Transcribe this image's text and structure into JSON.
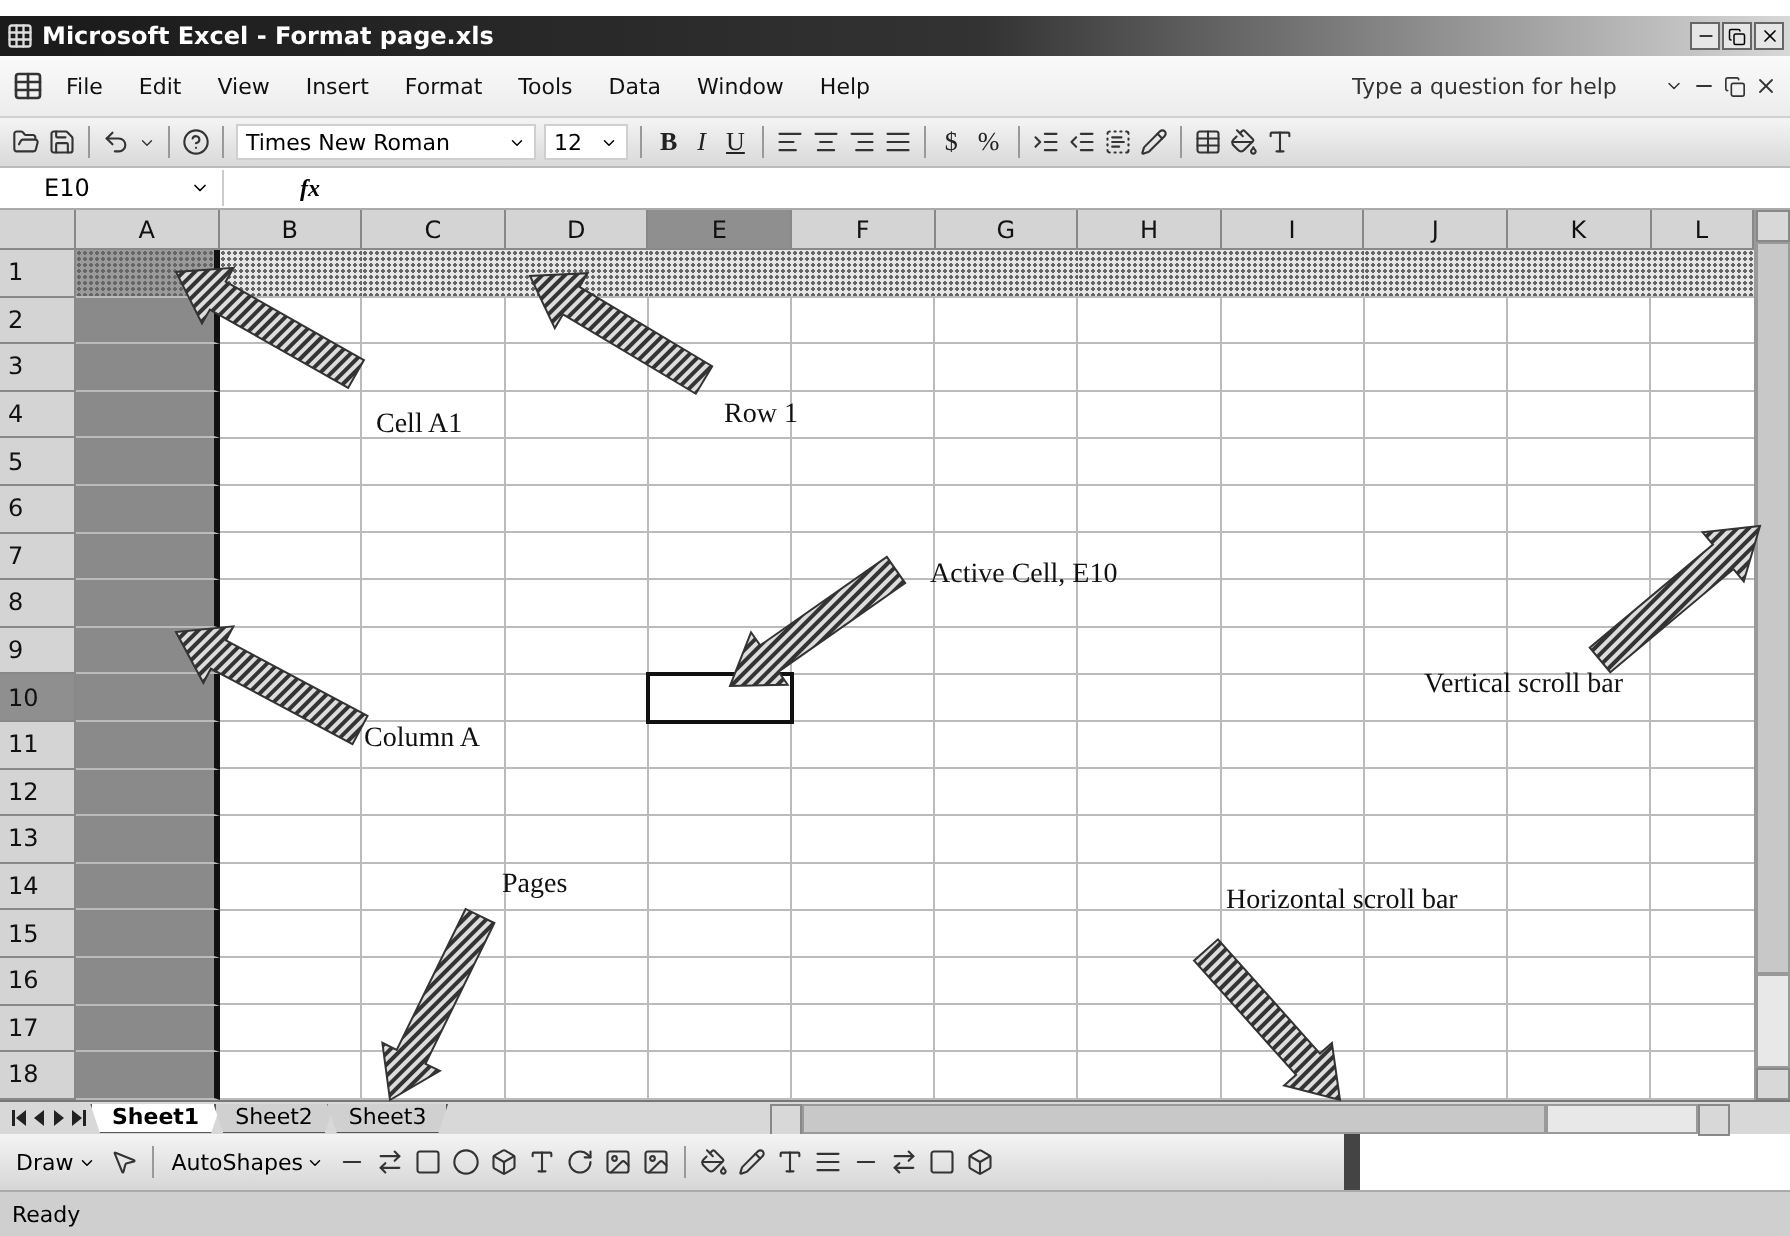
{
  "window": {
    "title": "Microsoft Excel - Format page.xls"
  },
  "menu": [
    "File",
    "Edit",
    "View",
    "Insert",
    "Format",
    "Tools",
    "Data",
    "Window",
    "Help"
  ],
  "help_box": {
    "placeholder": "Type a question for help"
  },
  "toolbar": {
    "font": "Times New Roman",
    "size": "12",
    "buttons": [
      {
        "label": "B",
        "kind": "bold"
      },
      {
        "label": "I",
        "kind": "italic"
      },
      {
        "label": "U",
        "kind": "underline"
      },
      {
        "label": "$",
        "kind": "plain"
      },
      {
        "label": "%",
        "kind": "plain"
      }
    ]
  },
  "formula_bar": {
    "name_box": "E10",
    "function_label": "fx"
  },
  "columns": [
    {
      "label": "A",
      "selected": false,
      "shaded": true
    },
    {
      "label": "B",
      "selected": false,
      "shaded": false
    },
    {
      "label": "C",
      "selected": false,
      "shaded": false
    },
    {
      "label": "D",
      "selected": false,
      "shaded": false
    },
    {
      "label": "E",
      "selected": true,
      "shaded": false
    },
    {
      "label": "F",
      "selected": false,
      "shaded": false
    },
    {
      "label": "G",
      "selected": false,
      "shaded": false
    },
    {
      "label": "H",
      "selected": false,
      "shaded": false
    },
    {
      "label": "I",
      "selected": false,
      "shaded": false
    },
    {
      "label": "J",
      "selected": false,
      "shaded": false
    },
    {
      "label": "K",
      "selected": false,
      "shaded": false
    },
    {
      "label": "L",
      "selected": false,
      "shaded": false
    }
  ],
  "rows": [
    {
      "label": "1",
      "selected": false,
      "shaded": true
    },
    {
      "label": "2",
      "selected": false,
      "shaded": false
    },
    {
      "label": "3",
      "selected": false,
      "shaded": false
    },
    {
      "label": "4",
      "selected": false,
      "shaded": false
    },
    {
      "label": "5",
      "selected": false,
      "shaded": false
    },
    {
      "label": "6",
      "selected": false,
      "shaded": false
    },
    {
      "label": "7",
      "selected": false,
      "shaded": false
    },
    {
      "label": "8",
      "selected": false,
      "shaded": false
    },
    {
      "label": "9",
      "selected": false,
      "shaded": false
    },
    {
      "label": "10",
      "selected": true,
      "shaded": false
    },
    {
      "label": "11",
      "selected": false,
      "shaded": false
    },
    {
      "label": "12",
      "selected": false,
      "shaded": false
    },
    {
      "label": "13",
      "selected": false,
      "shaded": false
    },
    {
      "label": "14",
      "selected": false,
      "shaded": false
    },
    {
      "label": "15",
      "selected": false,
      "shaded": false
    },
    {
      "label": "16",
      "selected": false,
      "shaded": false
    },
    {
      "label": "17",
      "selected": false,
      "shaded": false
    },
    {
      "label": "18",
      "selected": false,
      "shaded": false
    }
  ],
  "sheet_tabs": [
    {
      "label": "Sheet1",
      "selected": true
    },
    {
      "label": "Sheet2",
      "selected": false
    },
    {
      "label": "Sheet3",
      "selected": false
    }
  ],
  "drawing_toolbar": {
    "draw": "Draw",
    "autoshapes": "AutoShapes"
  },
  "annotations": [
    {
      "text": "Cell A1"
    },
    {
      "text": "Row 1"
    },
    {
      "text": "Active Cell, E10"
    },
    {
      "text": "Column A"
    },
    {
      "text": "Vertical scroll bar"
    },
    {
      "text": "Pages"
    },
    {
      "text": "Horizontal scroll bar"
    }
  ],
  "status_bar": {
    "text": "Ready"
  }
}
